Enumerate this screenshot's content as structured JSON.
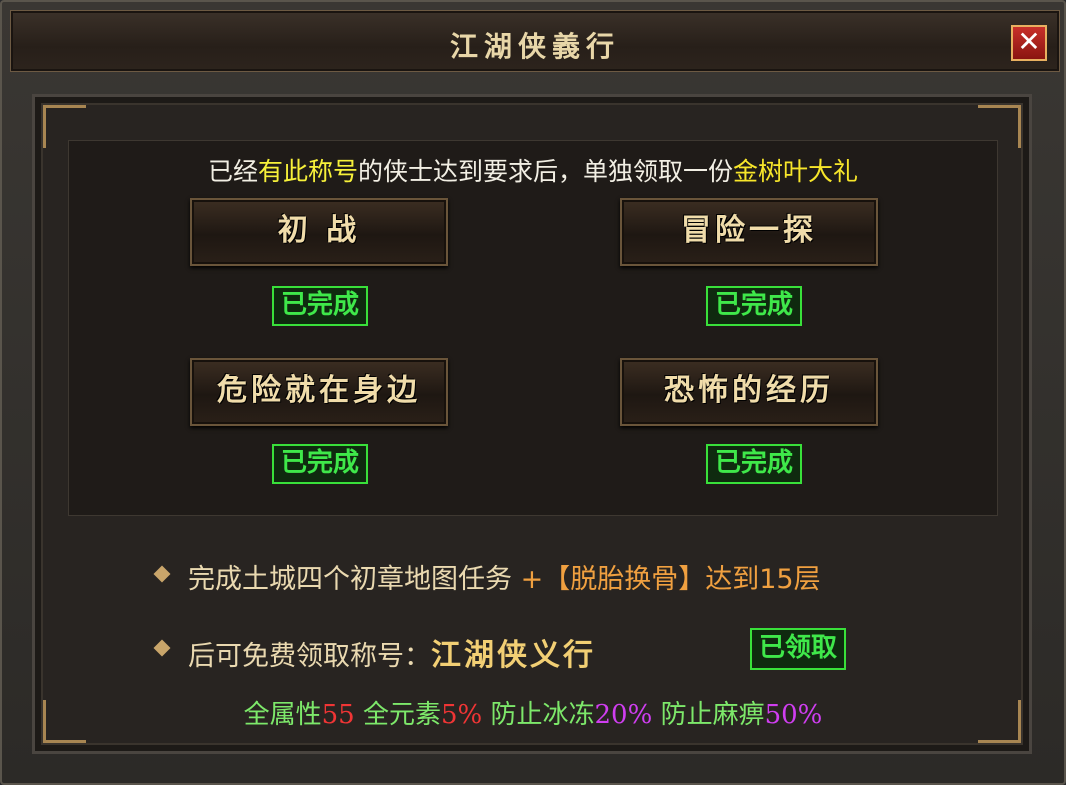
{
  "window": {
    "title": "江湖侠義行",
    "close_label": "✕"
  },
  "intro": {
    "part1": "已经",
    "highlight1": "有此称号",
    "part2": "的侠士达到要求后，单独领取一份",
    "highlight2": "金树叶大礼"
  },
  "achievements": [
    {
      "title": "初  战",
      "status": "已完成"
    },
    {
      "title": "冒险一探",
      "status": "已完成"
    },
    {
      "title": "危险就在身边",
      "status": "已完成"
    },
    {
      "title": "恐怖的经历",
      "status": "已完成"
    }
  ],
  "requirement": {
    "text": "完成土城四个初章地图任务",
    "plus": "+【脱胎换骨】达到15层"
  },
  "reward": {
    "prefix": "后可免费领取称号：",
    "title_name": "江湖侠义行",
    "claim_status": "已领取"
  },
  "stats": [
    {
      "label": "全属性",
      "value": "55",
      "color": "red"
    },
    {
      "label": "全元素",
      "value": "5%",
      "color": "red"
    },
    {
      "label": "防止冰冻",
      "value": "20%",
      "color": "purple"
    },
    {
      "label": "防止麻痹",
      "value": "50%",
      "color": "purple"
    }
  ]
}
